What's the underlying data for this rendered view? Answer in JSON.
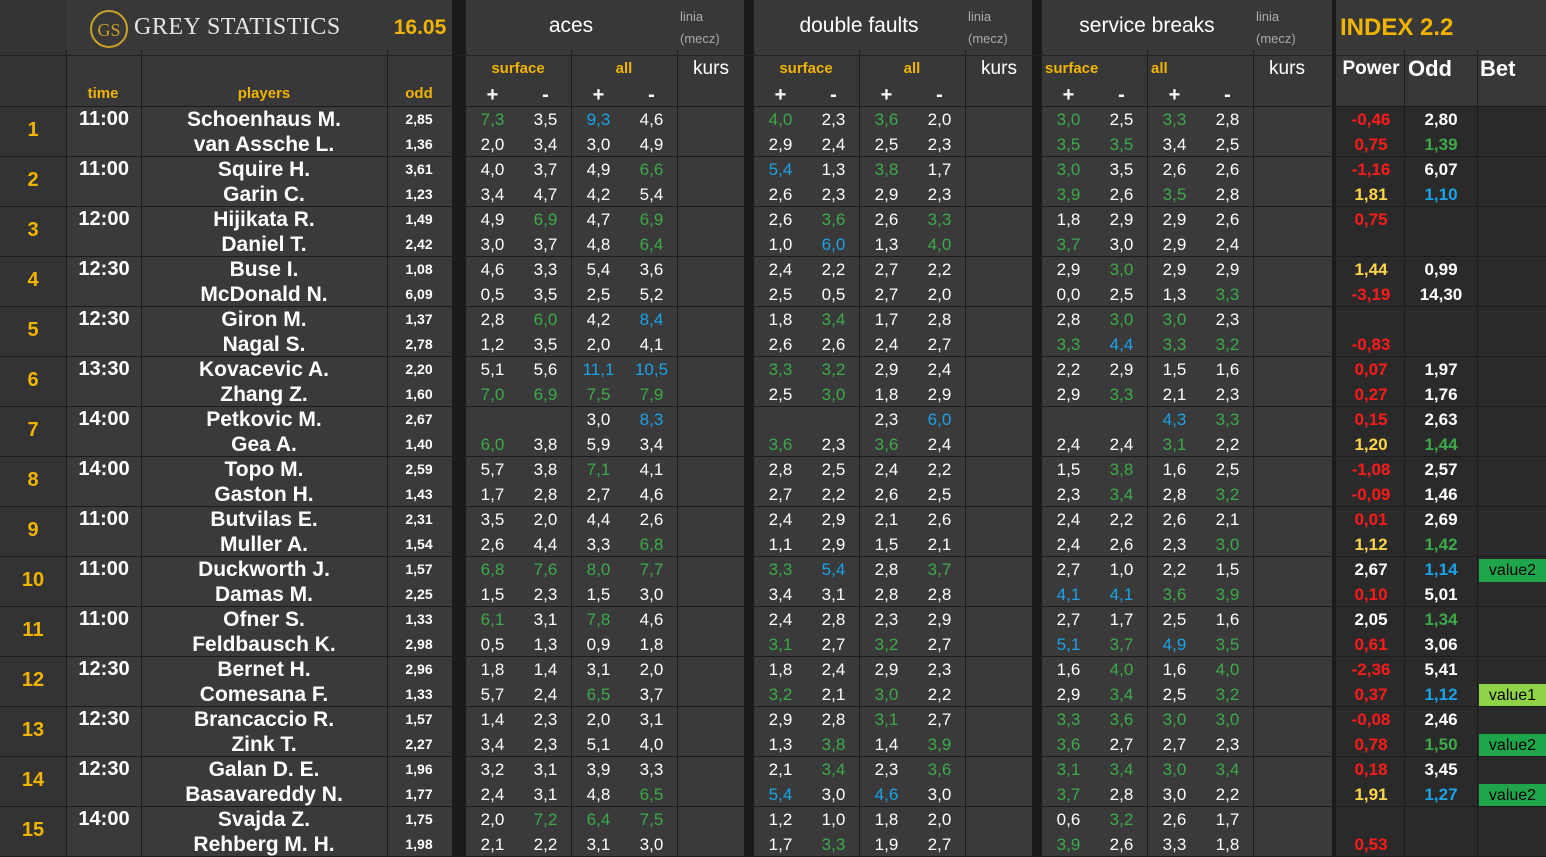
{
  "brand": {
    "logo": "GS",
    "name": "GREY STATISTICS",
    "date": "16.05"
  },
  "sections": {
    "aces": "aces",
    "double_faults": "double faults",
    "service_breaks": "service breaks",
    "index": "INDEX 2.2",
    "linia": "linia",
    "mecz": "(mecz)",
    "kurs": "kurs",
    "surface": "surface",
    "all": "all",
    "plus": "+",
    "minus": "-"
  },
  "columns": {
    "time": "time",
    "players": "players",
    "odd": "odd",
    "power": "Power",
    "odd2": "Odd",
    "bet": "Bet"
  },
  "colors": {
    "green": "#3daa4a",
    "blue": "#1aa3e8",
    "red": "#ff1a1a",
    "yellow": "#f0b400"
  },
  "matches": [
    {
      "num": "1",
      "time": "11:00",
      "players": [
        {
          "name": "Schoenhaus M.",
          "odd": "2,85",
          "aces": [
            "7,3",
            "3,5",
            "9,3",
            "4,6"
          ],
          "df": [
            "4,0",
            "2,3",
            "3,6",
            "2,0"
          ],
          "sb": [
            "3,0",
            "2,5",
            "3,3",
            "2,8"
          ],
          "power": "-0,46",
          "odd2": "2,80",
          "bet": ""
        },
        {
          "name": "van Assche L.",
          "odd": "1,36",
          "aces": [
            "2,0",
            "3,4",
            "3,0",
            "4,9"
          ],
          "df": [
            "2,9",
            "2,4",
            "2,5",
            "2,3"
          ],
          "sb": [
            "3,5",
            "3,5",
            "3,4",
            "2,5"
          ],
          "power": "0,75",
          "odd2": "1,39",
          "bet": ""
        }
      ]
    },
    {
      "num": "2",
      "time": "11:00",
      "players": [
        {
          "name": "Squire H.",
          "odd": "3,61",
          "aces": [
            "4,0",
            "3,7",
            "4,9",
            "6,6"
          ],
          "df": [
            "5,4",
            "1,3",
            "3,8",
            "1,7"
          ],
          "sb": [
            "3,0",
            "3,5",
            "2,6",
            "2,6"
          ],
          "power": "-1,16",
          "odd2": "6,07",
          "bet": ""
        },
        {
          "name": "Garin C.",
          "odd": "1,23",
          "aces": [
            "3,4",
            "4,7",
            "4,2",
            "5,4"
          ],
          "df": [
            "2,6",
            "2,3",
            "2,9",
            "2,3"
          ],
          "sb": [
            "3,9",
            "2,6",
            "3,5",
            "2,8"
          ],
          "power": "1,81",
          "odd2": "1,10",
          "bet": ""
        }
      ]
    },
    {
      "num": "3",
      "time": "12:00",
      "players": [
        {
          "name": "Hijikata R.",
          "odd": "1,49",
          "aces": [
            "4,9",
            "6,9",
            "4,7",
            "6,9"
          ],
          "df": [
            "2,6",
            "3,6",
            "2,6",
            "3,3"
          ],
          "sb": [
            "1,8",
            "2,9",
            "2,9",
            "2,6"
          ],
          "power": "0,75",
          "odd2": "",
          "bet": ""
        },
        {
          "name": "Daniel T.",
          "odd": "2,42",
          "aces": [
            "3,0",
            "3,7",
            "4,8",
            "6,4"
          ],
          "df": [
            "1,0",
            "6,0",
            "1,3",
            "4,0"
          ],
          "sb": [
            "3,7",
            "3,0",
            "2,9",
            "2,4"
          ],
          "power": "",
          "odd2": "",
          "bet": ""
        }
      ]
    },
    {
      "num": "4",
      "time": "12:30",
      "players": [
        {
          "name": "Buse I.",
          "odd": "1,08",
          "aces": [
            "4,6",
            "3,3",
            "5,4",
            "3,6"
          ],
          "df": [
            "2,4",
            "2,2",
            "2,7",
            "2,2"
          ],
          "sb": [
            "2,9",
            "3,0",
            "2,9",
            "2,9"
          ],
          "power": "1,44",
          "odd2": "0,99",
          "bet": ""
        },
        {
          "name": "McDonald N.",
          "odd": "6,09",
          "aces": [
            "0,5",
            "3,5",
            "2,5",
            "5,2"
          ],
          "df": [
            "2,5",
            "0,5",
            "2,7",
            "2,0"
          ],
          "sb": [
            "0,0",
            "2,5",
            "1,3",
            "3,3"
          ],
          "power": "-3,19",
          "odd2": "14,30",
          "bet": ""
        }
      ]
    },
    {
      "num": "5",
      "time": "12:30",
      "players": [
        {
          "name": "Giron M.",
          "odd": "1,37",
          "aces": [
            "2,8",
            "6,0",
            "4,2",
            "8,4"
          ],
          "df": [
            "1,8",
            "3,4",
            "1,7",
            "2,8"
          ],
          "sb": [
            "2,8",
            "3,0",
            "3,0",
            "2,3"
          ],
          "power": "",
          "odd2": "",
          "bet": ""
        },
        {
          "name": "Nagal S.",
          "odd": "2,78",
          "aces": [
            "1,2",
            "3,5",
            "2,0",
            "4,1"
          ],
          "df": [
            "2,6",
            "2,6",
            "2,4",
            "2,7"
          ],
          "sb": [
            "3,3",
            "4,4",
            "3,3",
            "3,2"
          ],
          "power": "-0,83",
          "odd2": "",
          "bet": ""
        }
      ]
    },
    {
      "num": "6",
      "time": "13:30",
      "players": [
        {
          "name": "Kovacevic A.",
          "odd": "2,20",
          "aces": [
            "5,1",
            "5,6",
            "11,1",
            "10,5"
          ],
          "df": [
            "3,3",
            "3,2",
            "2,9",
            "2,4"
          ],
          "sb": [
            "2,2",
            "2,9",
            "1,5",
            "1,6"
          ],
          "power": "0,07",
          "odd2": "1,97",
          "bet": ""
        },
        {
          "name": "Zhang Z.",
          "odd": "1,60",
          "aces": [
            "7,0",
            "6,9",
            "7,5",
            "7,9"
          ],
          "df": [
            "2,5",
            "3,0",
            "1,8",
            "2,9"
          ],
          "sb": [
            "2,9",
            "3,3",
            "2,1",
            "2,3"
          ],
          "power": "0,27",
          "odd2": "1,76",
          "bet": ""
        }
      ]
    },
    {
      "num": "7",
      "time": "14:00",
      "players": [
        {
          "name": "Petkovic M.",
          "odd": "2,67",
          "aces": [
            "",
            "",
            "3,0",
            "8,3"
          ],
          "df": [
            "",
            "",
            "2,3",
            "6,0"
          ],
          "sb": [
            "",
            "",
            "4,3",
            "3,3"
          ],
          "power": "0,15",
          "odd2": "2,63",
          "bet": ""
        },
        {
          "name": "Gea A.",
          "odd": "1,40",
          "aces": [
            "6,0",
            "3,8",
            "5,9",
            "3,4"
          ],
          "df": [
            "3,6",
            "2,3",
            "3,6",
            "2,4"
          ],
          "sb": [
            "2,4",
            "2,4",
            "3,1",
            "2,2"
          ],
          "power": "1,20",
          "odd2": "1,44",
          "bet": ""
        }
      ]
    },
    {
      "num": "8",
      "time": "14:00",
      "players": [
        {
          "name": "Topo M.",
          "odd": "2,59",
          "aces": [
            "5,7",
            "3,8",
            "7,1",
            "4,1"
          ],
          "df": [
            "2,8",
            "2,5",
            "2,4",
            "2,2"
          ],
          "sb": [
            "1,5",
            "3,8",
            "1,6",
            "2,5"
          ],
          "power": "-1,08",
          "odd2": "2,57",
          "bet": ""
        },
        {
          "name": "Gaston H.",
          "odd": "1,43",
          "aces": [
            "1,7",
            "2,8",
            "2,7",
            "4,6"
          ],
          "df": [
            "2,7",
            "2,2",
            "2,6",
            "2,5"
          ],
          "sb": [
            "2,3",
            "3,4",
            "2,8",
            "3,2"
          ],
          "power": "-0,09",
          "odd2": "1,46",
          "bet": ""
        }
      ]
    },
    {
      "num": "9",
      "time": "11:00",
      "players": [
        {
          "name": "Butvilas E.",
          "odd": "2,31",
          "aces": [
            "3,5",
            "2,0",
            "4,4",
            "2,6"
          ],
          "df": [
            "2,4",
            "2,9",
            "2,1",
            "2,6"
          ],
          "sb": [
            "2,4",
            "2,2",
            "2,6",
            "2,1"
          ],
          "power": "0,01",
          "odd2": "2,69",
          "bet": ""
        },
        {
          "name": "Muller A.",
          "odd": "1,54",
          "aces": [
            "2,6",
            "4,4",
            "3,3",
            "6,8"
          ],
          "df": [
            "1,1",
            "2,9",
            "1,5",
            "2,1"
          ],
          "sb": [
            "2,4",
            "2,6",
            "2,3",
            "3,0"
          ],
          "power": "1,12",
          "odd2": "1,42",
          "bet": ""
        }
      ]
    },
    {
      "num": "10",
      "time": "11:00",
      "players": [
        {
          "name": "Duckworth J.",
          "odd": "1,57",
          "aces": [
            "6,8",
            "7,6",
            "8,0",
            "7,7"
          ],
          "df": [
            "3,3",
            "5,4",
            "2,8",
            "3,7"
          ],
          "sb": [
            "2,7",
            "1,0",
            "2,2",
            "1,5"
          ],
          "power": "2,67",
          "odd2": "1,14",
          "bet": "value2"
        },
        {
          "name": "Damas M.",
          "odd": "2,25",
          "aces": [
            "1,5",
            "2,3",
            "1,5",
            "3,0"
          ],
          "df": [
            "3,4",
            "3,1",
            "2,8",
            "2,8"
          ],
          "sb": [
            "4,1",
            "4,1",
            "3,6",
            "3,9"
          ],
          "power": "0,10",
          "odd2": "5,01",
          "bet": ""
        }
      ]
    },
    {
      "num": "11",
      "time": "11:00",
      "players": [
        {
          "name": "Ofner S.",
          "odd": "1,33",
          "aces": [
            "6,1",
            "3,1",
            "7,8",
            "4,6"
          ],
          "df": [
            "2,4",
            "2,8",
            "2,3",
            "2,9"
          ],
          "sb": [
            "2,7",
            "1,7",
            "2,5",
            "1,6"
          ],
          "power": "2,05",
          "odd2": "1,34",
          "bet": ""
        },
        {
          "name": "Feldbausch K.",
          "odd": "2,98",
          "aces": [
            "0,5",
            "1,3",
            "0,9",
            "1,8"
          ],
          "df": [
            "3,1",
            "2,7",
            "3,2",
            "2,7"
          ],
          "sb": [
            "5,1",
            "3,7",
            "4,9",
            "3,5"
          ],
          "power": "0,61",
          "odd2": "3,06",
          "bet": ""
        }
      ]
    },
    {
      "num": "12",
      "time": "12:30",
      "players": [
        {
          "name": "Bernet H.",
          "odd": "2,96",
          "aces": [
            "1,8",
            "1,4",
            "3,1",
            "2,0"
          ],
          "df": [
            "1,8",
            "2,4",
            "2,9",
            "2,3"
          ],
          "sb": [
            "1,6",
            "4,0",
            "1,6",
            "4,0"
          ],
          "power": "-2,36",
          "odd2": "5,41",
          "bet": ""
        },
        {
          "name": "Comesana F.",
          "odd": "1,33",
          "aces": [
            "5,7",
            "2,4",
            "6,5",
            "3,7"
          ],
          "df": [
            "3,2",
            "2,1",
            "3,0",
            "2,2"
          ],
          "sb": [
            "2,9",
            "3,4",
            "2,5",
            "3,2"
          ],
          "power": "0,37",
          "odd2": "1,12",
          "bet": "value1"
        }
      ]
    },
    {
      "num": "13",
      "time": "12:30",
      "players": [
        {
          "name": "Brancaccio R.",
          "odd": "1,57",
          "aces": [
            "1,4",
            "2,3",
            "2,0",
            "3,1"
          ],
          "df": [
            "2,9",
            "2,8",
            "3,1",
            "2,7"
          ],
          "sb": [
            "3,3",
            "3,6",
            "3,0",
            "3,0"
          ],
          "power": "-0,08",
          "odd2": "2,46",
          "bet": ""
        },
        {
          "name": "Zink T.",
          "odd": "2,27",
          "aces": [
            "3,4",
            "2,3",
            "5,1",
            "4,0"
          ],
          "df": [
            "1,3",
            "3,8",
            "1,4",
            "3,9"
          ],
          "sb": [
            "3,6",
            "2,7",
            "2,7",
            "2,3"
          ],
          "power": "0,78",
          "odd2": "1,50",
          "bet": "value2"
        }
      ]
    },
    {
      "num": "14",
      "time": "12:30",
      "players": [
        {
          "name": "Galan D. E.",
          "odd": "1,96",
          "aces": [
            "3,2",
            "3,1",
            "3,9",
            "3,3"
          ],
          "df": [
            "2,1",
            "3,4",
            "2,3",
            "3,6"
          ],
          "sb": [
            "3,1",
            "3,4",
            "3,0",
            "3,4"
          ],
          "power": "0,18",
          "odd2": "3,45",
          "bet": ""
        },
        {
          "name": "Basavareddy N.",
          "odd": "1,77",
          "aces": [
            "2,4",
            "3,1",
            "4,8",
            "6,5"
          ],
          "df": [
            "5,4",
            "3,0",
            "4,6",
            "3,0"
          ],
          "sb": [
            "3,7",
            "2,8",
            "3,0",
            "2,2"
          ],
          "power": "1,91",
          "odd2": "1,27",
          "bet": "value2"
        }
      ]
    },
    {
      "num": "15",
      "time": "14:00",
      "players": [
        {
          "name": "Svajda Z.",
          "odd": "1,75",
          "aces": [
            "2,0",
            "7,2",
            "6,4",
            "7,5"
          ],
          "df": [
            "1,2",
            "1,0",
            "1,8",
            "2,0"
          ],
          "sb": [
            "0,6",
            "3,2",
            "2,6",
            "1,7"
          ],
          "power": "",
          "odd2": "",
          "bet": ""
        },
        {
          "name": "Rehberg M. H.",
          "odd": "1,98",
          "aces": [
            "2,1",
            "2,2",
            "3,1",
            "3,0"
          ],
          "df": [
            "1,7",
            "3,3",
            "1,9",
            "2,7"
          ],
          "sb": [
            "3,9",
            "2,6",
            "3,3",
            "1,8"
          ],
          "power": "0,53",
          "odd2": "",
          "bet": ""
        }
      ]
    }
  ]
}
